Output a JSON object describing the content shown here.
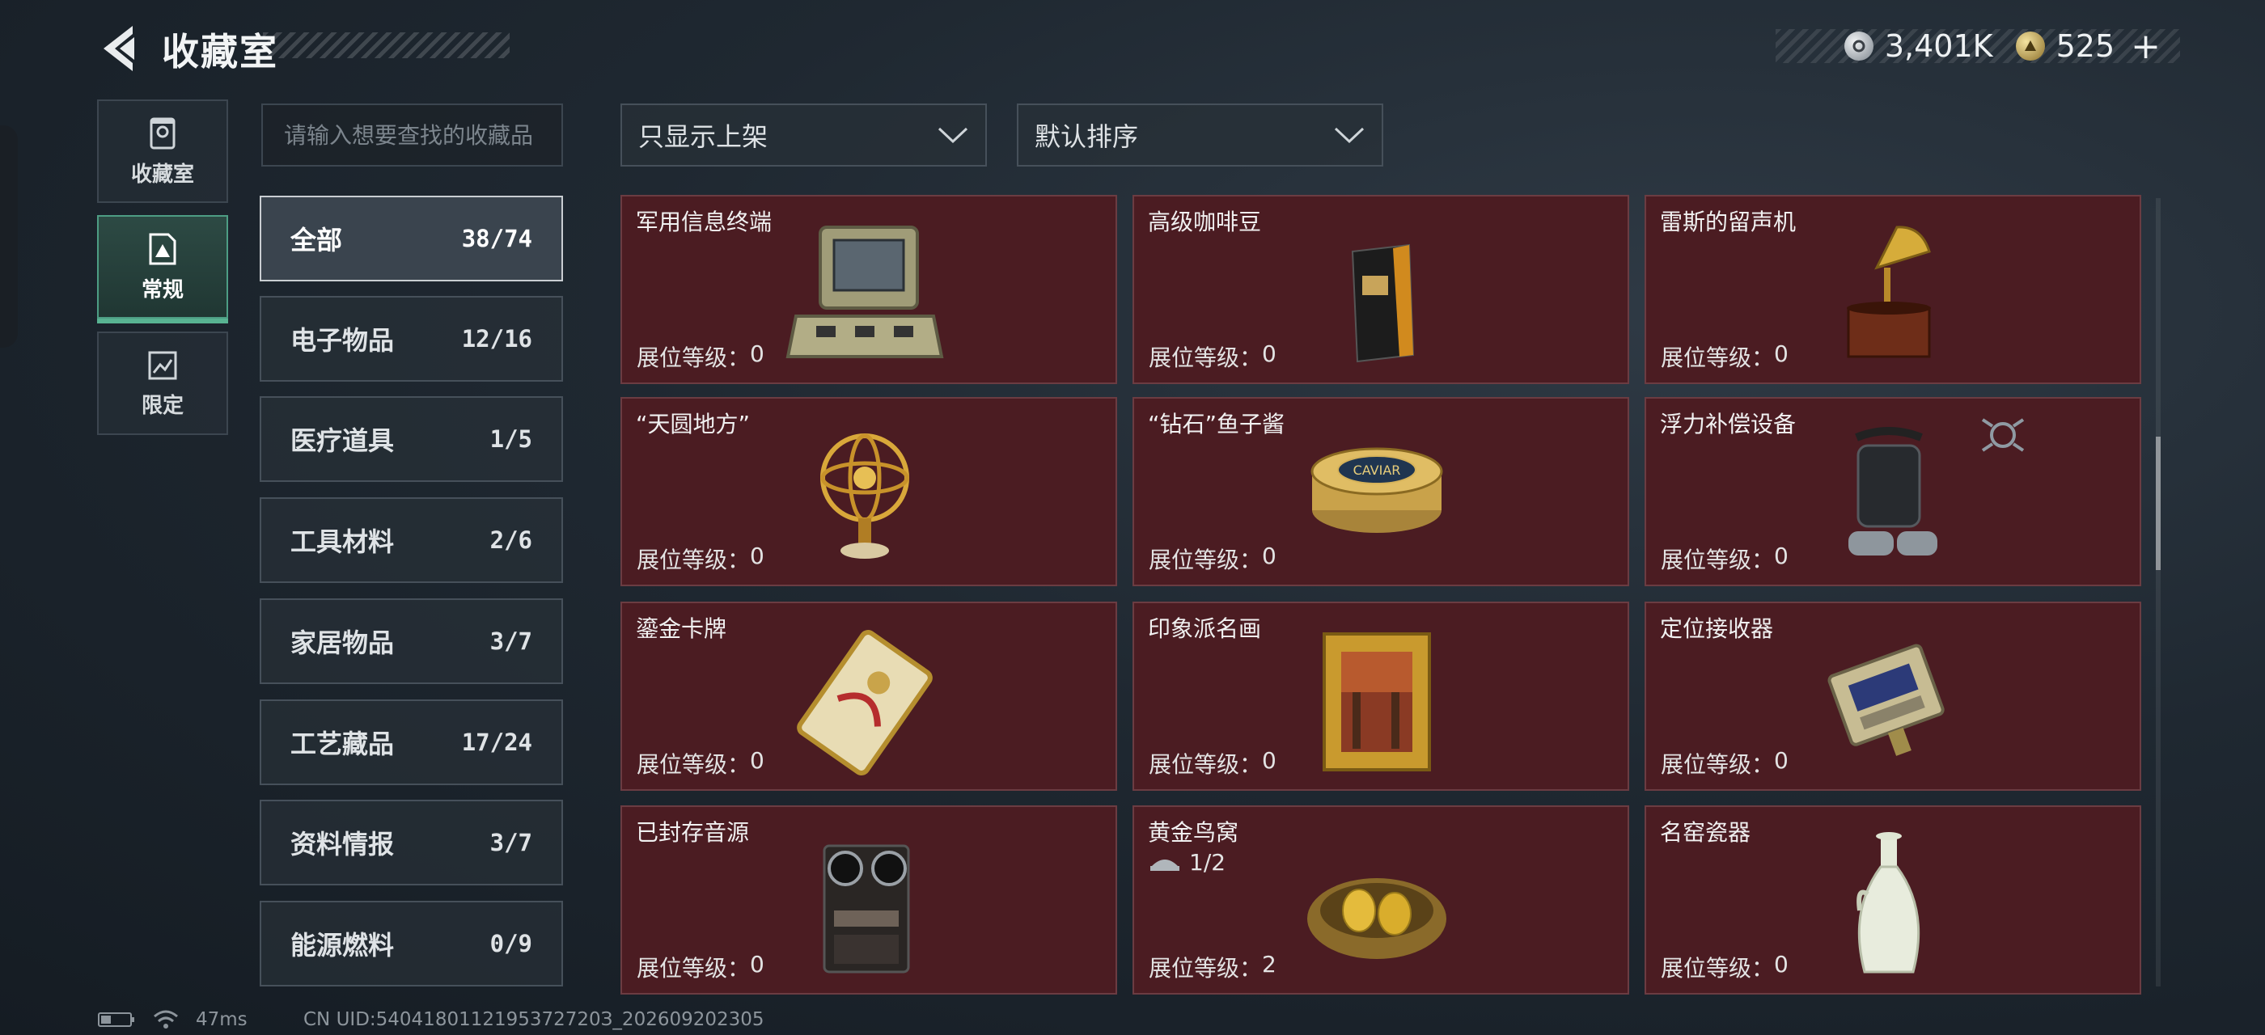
{
  "header": {
    "title": "收藏室",
    "currencies": [
      {
        "icon": "silver-coin-icon",
        "value": "3,401K"
      },
      {
        "icon": "gold-coin-icon",
        "value": "525"
      }
    ],
    "add_symbol": "+"
  },
  "left_nav": [
    {
      "label": "收藏室",
      "icon": "collection-room-icon",
      "active": false
    },
    {
      "label": "常规",
      "icon": "regular-icon",
      "active": true
    },
    {
      "label": "限定",
      "icon": "limited-icon",
      "active": false
    }
  ],
  "search": {
    "placeholder": "请输入想要查找的收藏品"
  },
  "categories": [
    {
      "label": "全部",
      "count": "38/74",
      "active": true
    },
    {
      "label": "电子物品",
      "count": "12/16"
    },
    {
      "label": "医疗道具",
      "count": "1/5"
    },
    {
      "label": "工具材料",
      "count": "2/6"
    },
    {
      "label": "家居物品",
      "count": "3/7"
    },
    {
      "label": "工艺藏品",
      "count": "17/24"
    },
    {
      "label": "资料情报",
      "count": "3/7"
    },
    {
      "label": "能源燃料",
      "count": "0/9"
    }
  ],
  "filters": {
    "display": "只显示上架",
    "sort": "默认排序"
  },
  "level_label": "展位等级：",
  "items": [
    {
      "name": "军用信息终端",
      "level": "0",
      "icon": "military-terminal-icon"
    },
    {
      "name": "高级咖啡豆",
      "level": "0",
      "icon": "coffee-bag-icon"
    },
    {
      "name": "雷斯的留声机",
      "level": "0",
      "icon": "gramophone-icon"
    },
    {
      "name": "“天圆地方”",
      "level": "0",
      "icon": "armillary-sphere-icon"
    },
    {
      "name": "“钻石”鱼子酱",
      "level": "0",
      "icon": "caviar-tin-icon",
      "tin_text": "CAVIAR"
    },
    {
      "name": "浮力补偿设备",
      "level": "0",
      "icon": "buoyancy-device-icon",
      "badge": "target-icon"
    },
    {
      "name": "鎏金卡牌",
      "level": "0",
      "icon": "gilded-card-icon"
    },
    {
      "name": "印象派名画",
      "level": "0",
      "icon": "framed-painting-icon"
    },
    {
      "name": "定位接收器",
      "level": "0",
      "icon": "locator-receiver-icon"
    },
    {
      "name": "已封存音源",
      "level": "0",
      "icon": "reel-recorder-icon"
    },
    {
      "name": "黄金鸟窝",
      "level": "2",
      "icon": "golden-nest-icon",
      "extra": "1/2",
      "extra_icon": "shelf-icon"
    },
    {
      "name": "名窑瓷器",
      "level": "0",
      "icon": "porcelain-vase-icon"
    }
  ],
  "footer": {
    "ping": "47ms",
    "uid": "CN UID:5404180112195372720З_202609202305"
  }
}
